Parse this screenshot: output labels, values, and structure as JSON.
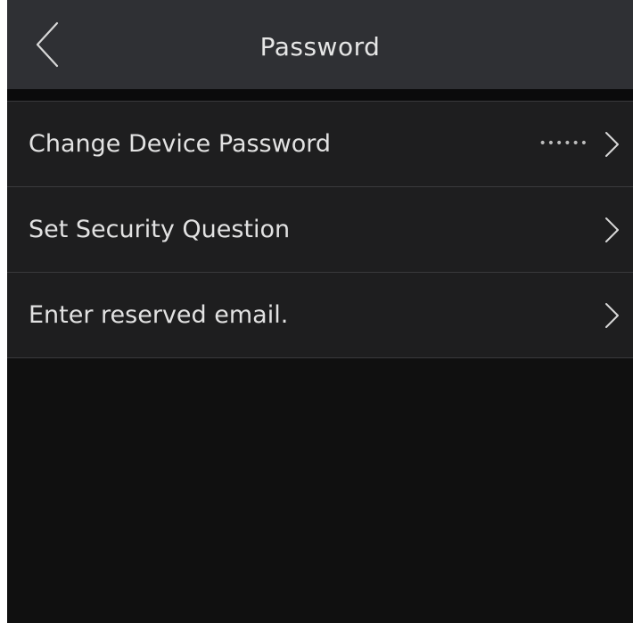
{
  "header": {
    "title": "Password",
    "back_icon": "chevron-left-icon"
  },
  "items": [
    {
      "label": "Change Device Password",
      "value": "••••••",
      "icon": "chevron-right-icon"
    },
    {
      "label": "Set Security Question",
      "value": "",
      "icon": "chevron-right-icon"
    },
    {
      "label": "Enter reserved email.",
      "value": "",
      "icon": "chevron-right-icon"
    }
  ],
  "colors": {
    "header_bg": "#2f3034",
    "screen_bg": "#101010",
    "row_bg": "#1e1e1f",
    "divider": "#3a3a3c",
    "text": "#e2e2e2"
  }
}
